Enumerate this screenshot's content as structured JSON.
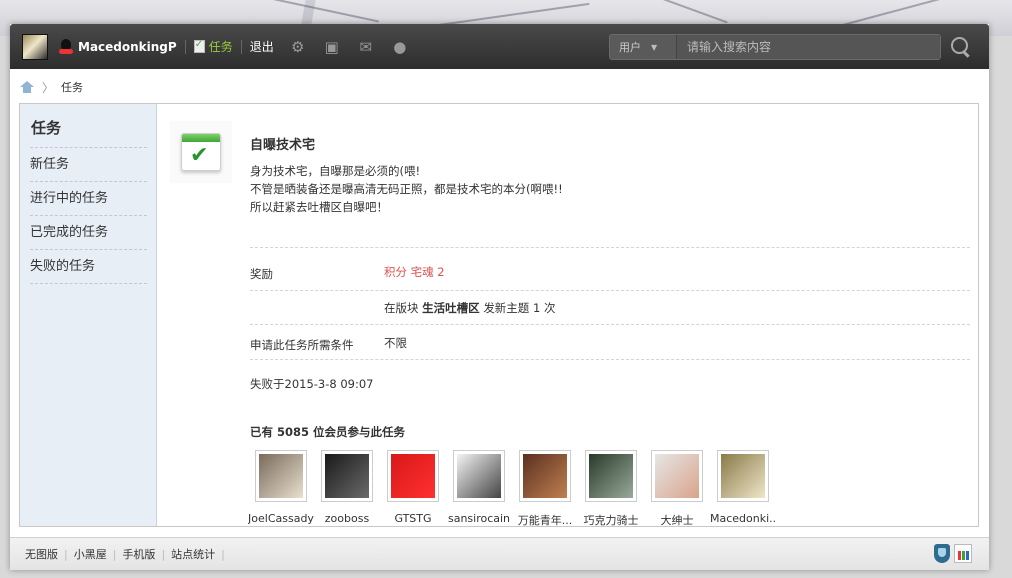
{
  "topbar": {
    "username": "MacedonkingP",
    "task_link": "任务",
    "logout": "退出",
    "icons": [
      "gear-icon",
      "image-icon",
      "mail-icon",
      "bulb-icon"
    ],
    "search_type": "用户",
    "search_placeholder": "请输入搜索内容"
  },
  "breadcrumb": {
    "separator": "〉",
    "current": "任务"
  },
  "sidebar": {
    "title": "任务",
    "items": [
      {
        "label": "新任务"
      },
      {
        "label": "进行中的任务"
      },
      {
        "label": "已完成的任务"
      },
      {
        "label": "失败的任务"
      }
    ]
  },
  "task": {
    "title": "自曝技术宅",
    "description": [
      "身为技术宅，自曝那是必须的(喂!",
      "不管是晒装备还是曝高清无码正照，都是技术宅的本分(啊喂!!",
      "所以赶紧去吐槽区自曝吧！"
    ],
    "reward_label": "奖励",
    "reward_value": "积分 宅魂 2",
    "condition_prefix": "在版块",
    "condition_forum": "生活吐槽区",
    "condition_suffix": "发新主题 1 次",
    "apply_label": "申请此任务所需条件",
    "apply_value": "不限",
    "failed_at": "失败于2015-3-8 09:07",
    "members_prefix": "已有",
    "members_count": "5085",
    "members_suffix": "位会员参与此任务",
    "members": [
      {
        "name": "JoelCassady",
        "colors": [
          "#7a6a5a",
          "#e8e0d0"
        ]
      },
      {
        "name": "zooboss",
        "colors": [
          "#1a1a1a",
          "#6a6a6a"
        ]
      },
      {
        "name": "GTSTG",
        "colors": [
          "#d81818",
          "#ff3030"
        ]
      },
      {
        "name": "sansirocain",
        "colors": [
          "#f4f4f4",
          "#444444"
        ]
      },
      {
        "name": "万能青年...",
        "colors": [
          "#5a3020",
          "#c08050"
        ]
      },
      {
        "name": "巧克力骑士",
        "colors": [
          "#2a3a2a",
          "#9aaa9a"
        ]
      },
      {
        "name": "大绅士",
        "colors": [
          "#e6e6e6",
          "#d9a38a"
        ]
      },
      {
        "name": "Macedonki...",
        "colors": [
          "#8a7a4a",
          "#efe6c8"
        ]
      }
    ]
  },
  "footer": {
    "links": [
      "无图版",
      "小黑屋",
      "手机版",
      "站点统计"
    ],
    "separator": "|"
  }
}
